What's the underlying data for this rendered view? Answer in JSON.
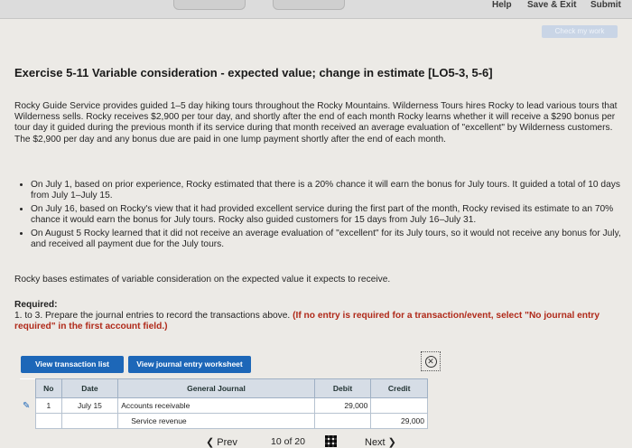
{
  "topnav": {
    "help": "Help",
    "save_exit": "Save & Exit",
    "submit": "Submit"
  },
  "check_work": "Check my work",
  "title": "Exercise 5-11 Variable consideration - expected value; change in estimate [LO5-3, 5-6]",
  "intro": "Rocky Guide Service provides guided 1–5 day hiking tours throughout the Rocky Mountains. Wilderness Tours hires Rocky to lead various tours that Wilderness sells. Rocky receives $2,900 per tour day, and shortly after the end of each month Rocky learns whether it will receive a $290 bonus per tour day it guided during the previous month if its service during that month received an average evaluation of \"excellent\" by Wilderness customers. The $2,900 per day and any bonus due are paid in one lump payment shortly after the end of each month.",
  "bullets": [
    "On July 1, based on prior experience, Rocky estimated that there is a 20% chance it will earn the bonus for July tours. It guided a total of 10 days from July 1–July 15.",
    "On July 16, based on Rocky's view that it had provided excellent service during the first part of the month, Rocky revised its estimate to an 70% chance it would earn the bonus for July tours. Rocky also guided customers for 15 days from July 16–July 31.",
    "On August 5 Rocky learned that it did not receive an average evaluation of \"excellent\" for its July tours, so it would not receive any bonus for July, and received all payment due for the July tours."
  ],
  "basis": "Rocky bases estimates of variable consideration on the expected value it expects to receive.",
  "required": {
    "heading": "Required:",
    "text": "1. to 3. Prepare the journal entries to record the transactions above.",
    "note": "(If no entry is required for a transaction/event, select \"No journal entry required\" in the first account field.)"
  },
  "buttons": {
    "view_list": "View transaction list",
    "view_worksheet": "View journal entry worksheet"
  },
  "table": {
    "headers": {
      "no": "No",
      "date": "Date",
      "general_journal": "General Journal",
      "debit": "Debit",
      "credit": "Credit"
    },
    "rows": [
      {
        "no": "1",
        "date": "July 15",
        "account": "Accounts receivable",
        "debit": "29,000",
        "credit": ""
      },
      {
        "no": "",
        "date": "",
        "account": "Service revenue",
        "debit": "",
        "credit": "29,000"
      }
    ]
  },
  "pagination": {
    "prev": "Prev",
    "current": "10",
    "of": "of",
    "total": "20",
    "next": "Next"
  }
}
